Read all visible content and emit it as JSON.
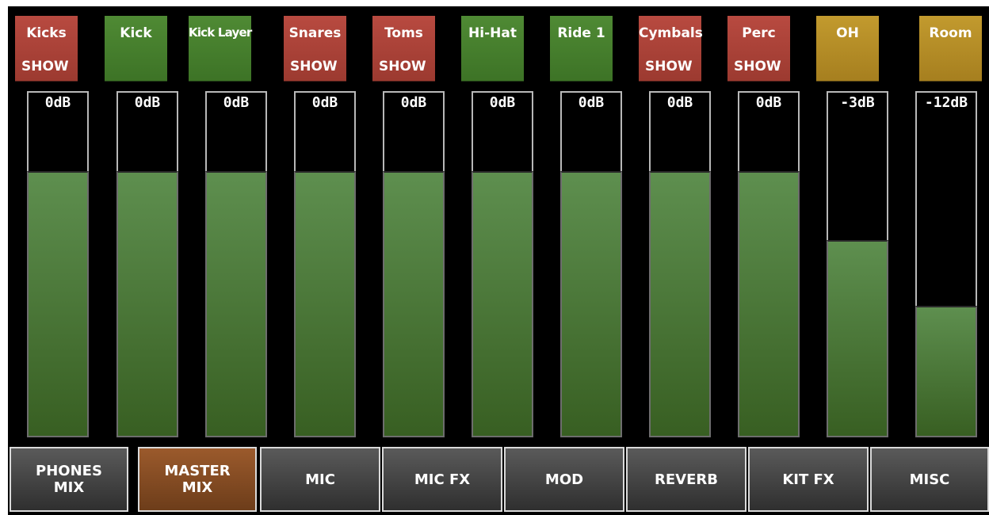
{
  "channels": [
    {
      "name": "Kicks",
      "show": "SHOW",
      "color": "#a8423a",
      "db": "0dB",
      "level": 0.77
    },
    {
      "name": "Kick",
      "show": "",
      "color": "#447d2d",
      "db": "0dB",
      "level": 0.77
    },
    {
      "name": "Kick Layer",
      "show": "",
      "color": "#447d2d",
      "db": "0dB",
      "level": 0.77
    },
    {
      "name": "Snares",
      "show": "SHOW",
      "color": "#a8423a",
      "db": "0dB",
      "level": 0.77
    },
    {
      "name": "Toms",
      "show": "SHOW",
      "color": "#a8423a",
      "db": "0dB",
      "level": 0.77
    },
    {
      "name": "Hi-Hat",
      "show": "",
      "color": "#447d2d",
      "db": "0dB",
      "level": 0.77
    },
    {
      "name": "Ride 1",
      "show": "",
      "color": "#447d2d",
      "db": "0dB",
      "level": 0.77
    },
    {
      "name": "Cymbals",
      "show": "SHOW",
      "color": "#a8423a",
      "db": "0dB",
      "level": 0.77
    },
    {
      "name": "Perc",
      "show": "SHOW",
      "color": "#a8423a",
      "db": "0dB",
      "level": 0.77
    },
    {
      "name": "OH",
      "show": "",
      "color": "#b58d27",
      "db": "-3dB",
      "level": 0.57
    },
    {
      "name": "Room",
      "show": "",
      "color": "#b58d27",
      "db": "-12dB",
      "level": 0.38
    }
  ],
  "tabs": [
    {
      "label": "PHONES MIX",
      "active": false
    },
    {
      "label": "MASTER MIX",
      "active": true
    },
    {
      "label": "MIC",
      "active": false
    },
    {
      "label": "MIC FX",
      "active": false
    },
    {
      "label": "MOD",
      "active": false
    },
    {
      "label": "REVERB",
      "active": false
    },
    {
      "label": "KIT FX",
      "active": false
    },
    {
      "label": "MISC",
      "active": false
    }
  ],
  "colors": {
    "background": "#000000",
    "fader_fill": "#4d7a3c",
    "active_tab": "#8a4f26"
  }
}
